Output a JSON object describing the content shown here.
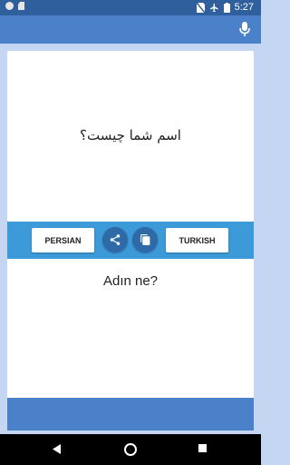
{
  "status_bar": {
    "time": "5:27",
    "icons": [
      "notification-dot-icon",
      "sd-card-icon",
      "no-sim-icon",
      "airplane-icon",
      "battery-icon"
    ]
  },
  "app_bar": {
    "icon": "microphone-icon"
  },
  "translation": {
    "source_text": "اسم شما چیست؟",
    "target_text": "Adın ne?"
  },
  "toolbar": {
    "source_language": "PERSIAN",
    "target_language": "TURKISH",
    "share_icon": "share-icon",
    "copy_icon": "copy-icon"
  },
  "nav_bar": {
    "icons": [
      "back-icon",
      "home-icon",
      "recents-icon"
    ]
  },
  "colors": {
    "status_bar": "#2f5f9c",
    "app_bar": "#4a81c9",
    "background": "#c5d6f2",
    "toolbar": "#3d9ad9",
    "circle_button": "#2f6aa8"
  }
}
